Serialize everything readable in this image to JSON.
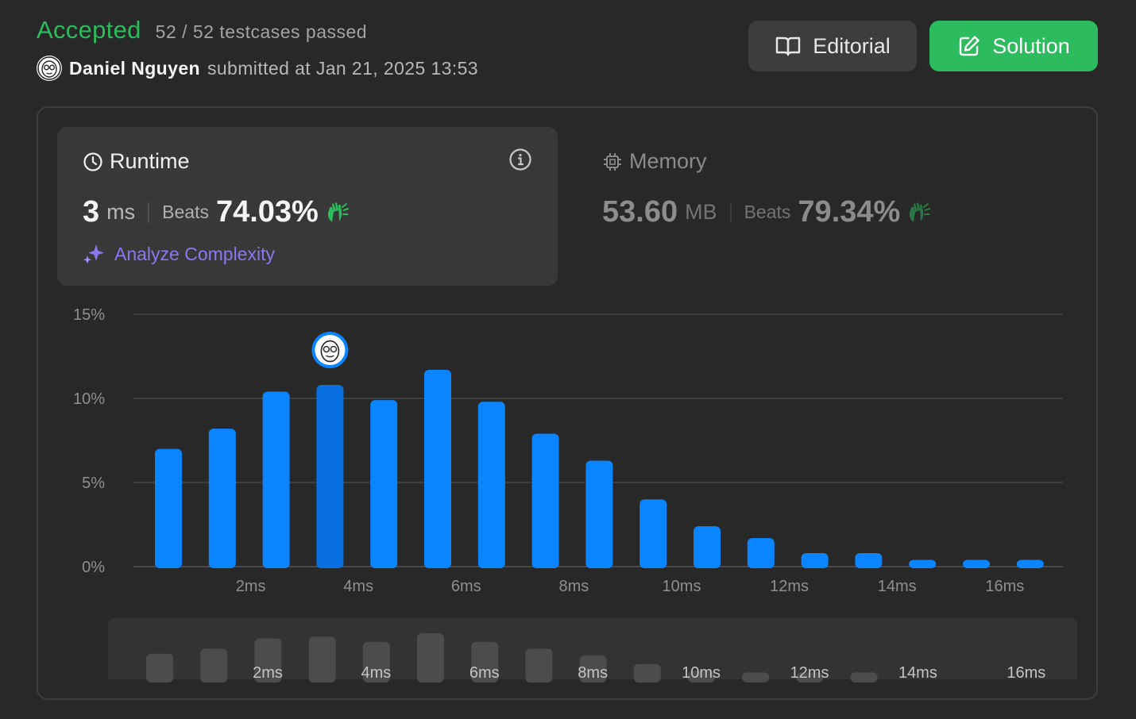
{
  "header": {
    "status": "Accepted",
    "testcases": "52 / 52 testcases passed",
    "user_name": "Daniel Nguyen",
    "submitted_text": "submitted at Jan 21, 2025 13:53"
  },
  "buttons": {
    "editorial": "Editorial",
    "solution": "Solution"
  },
  "runtime": {
    "title": "Runtime",
    "value": "3",
    "unit": "ms",
    "beats_label": "Beats",
    "beats_value": "74.03%",
    "analyze": "Analyze Complexity"
  },
  "memory": {
    "title": "Memory",
    "value": "53.60",
    "unit": "MB",
    "beats_label": "Beats",
    "beats_value": "79.34%"
  },
  "colors": {
    "accepted": "#2cbb5d",
    "bar": "#0a84ff",
    "bar_selected": "#0870e0",
    "analyze": "#8b78f0"
  },
  "chart_data": {
    "type": "bar",
    "x": [
      1,
      2,
      3,
      4,
      5,
      6,
      7,
      8,
      9,
      10,
      11,
      12,
      13,
      14,
      15,
      16,
      17
    ],
    "values": [
      7.0,
      8.2,
      10.4,
      10.8,
      9.9,
      11.7,
      9.8,
      7.9,
      6.3,
      4.0,
      2.4,
      1.7,
      0.8,
      0.8,
      0.4,
      0.4,
      0.4
    ],
    "selected_index": 3,
    "ylim": [
      0,
      15
    ],
    "yticks": [
      "0%",
      "5%",
      "10%",
      "15%"
    ],
    "xtick_labels": [
      "2ms",
      "4ms",
      "6ms",
      "8ms",
      "10ms",
      "12ms",
      "14ms",
      "16ms"
    ],
    "grid": true
  },
  "mini_chart": {
    "values": [
      1.5,
      1.8,
      2.4,
      2.5,
      2.2,
      2.7,
      2.2,
      1.8,
      1.4,
      0.9,
      0.5,
      0.4,
      0.4,
      0.4
    ],
    "labels": [
      "2ms",
      "4ms",
      "6ms",
      "8ms",
      "10ms",
      "12ms",
      "14ms",
      "16ms"
    ]
  }
}
